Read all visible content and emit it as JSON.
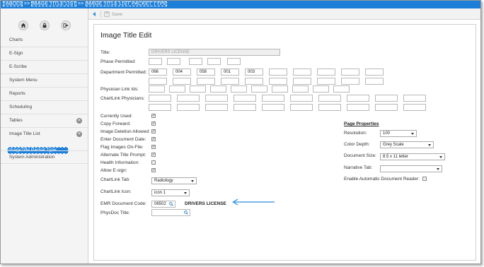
{
  "breadcrumb": [
    "TABLES",
    "IMAGE TITLE LIST",
    "IMAGE TITLE LIST PACKET TYPE"
  ],
  "toolbar": {
    "save_label": "Save"
  },
  "sidebar": {
    "items": [
      {
        "label": "Charts"
      },
      {
        "label": "E-Sign"
      },
      {
        "label": "E-Scribe"
      },
      {
        "label": "System Menu"
      },
      {
        "label": "Reports"
      },
      {
        "label": "Scheduling"
      },
      {
        "label": "Tables"
      },
      {
        "label": "Image Title List"
      },
      {
        "label": "ImageTitle Packet Type"
      },
      {
        "label": "System Administration"
      }
    ]
  },
  "page": {
    "title": "Image Title Edit"
  },
  "form": {
    "title_label": "Title:",
    "title_value": "DRIVERS LICENSE",
    "phase_label": "Phase Permitted:",
    "dept_label": "Department Permitted:",
    "dept_values": [
      "066",
      "004",
      "058",
      "001",
      "003"
    ],
    "physician_label": "Physician Link Ids:",
    "chartlink_phys_label": "ChartLink Physicians:",
    "checkboxes": [
      {
        "label": "Currently Used:",
        "checked": true
      },
      {
        "label": "Copy Forward:",
        "checked": true
      },
      {
        "label": "Image Deletion Allowed:",
        "checked": true
      },
      {
        "label": "Enter Document Date:",
        "checked": true
      },
      {
        "label": "Flag Images On-File:",
        "checked": true
      },
      {
        "label": "Alternate Title Prompt:",
        "checked": true
      },
      {
        "label": "Health Information:",
        "checked": false
      },
      {
        "label": "Allow E-sign:",
        "checked": true
      }
    ],
    "chartlink_tab_label": "ChartLink Tab:",
    "chartlink_tab_value": "Radiology",
    "chartlink_icon_label": "ChartLink Icon:",
    "chartlink_icon_value": "icon 1",
    "emr_label": "EMR Document Code:",
    "emr_value": "06502",
    "emr_desc": "DRIVERS LICENSE",
    "physdoc_label": "PhysDoc Title:",
    "physdoc_value": ""
  },
  "page_properties": {
    "heading": "Page Properties",
    "resolution_label": "Resolution:",
    "resolution_value": "100",
    "color_depth_label": "Color Depth:",
    "color_depth_value": "Grey Scale",
    "doc_size_label": "Document Size:",
    "doc_size_value": "8.5 x 11 letter",
    "narrative_label": "Narrative Tab:",
    "narrative_value": "",
    "auto_reader_label": "Enable Automatic Document Reader:",
    "auto_reader_checked": false
  },
  "colors": {
    "accent": "#1e7fd8",
    "arrow": "#2a8fe0"
  }
}
